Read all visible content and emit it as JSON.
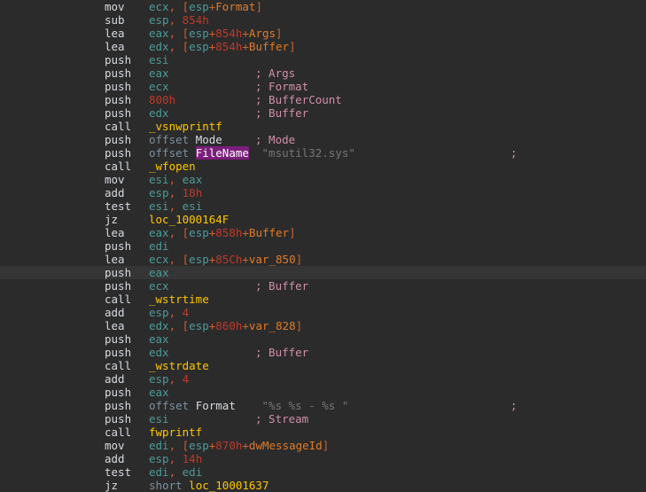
{
  "view": {
    "name": "disassembly-listing",
    "background": "#2b2b2b",
    "current_line_background": "#353535",
    "highlight_background": "#7b1e7b",
    "colors": {
      "mnemonic": "#d6dae0",
      "register": "#4e9a9a",
      "punctuation": "#c9622e",
      "number": "#c0392b",
      "variable": "#e07b28",
      "function": "#ffc600",
      "location": "#ffc600",
      "keyword": "#7d8fa0",
      "comment": "#d08faa",
      "string_comment": "#767676"
    }
  },
  "lines": [
    {
      "mnemonic": "mov",
      "operands": "ecx, [esp+Format]",
      "comment": "",
      "current": false
    },
    {
      "mnemonic": "sub",
      "operands": "esp, 854h",
      "comment": "",
      "current": false
    },
    {
      "mnemonic": "lea",
      "operands": "eax, [esp+854h+Args]",
      "comment": "",
      "current": false
    },
    {
      "mnemonic": "lea",
      "operands": "edx, [esp+854h+Buffer]",
      "comment": "",
      "current": false
    },
    {
      "mnemonic": "push",
      "operands": "esi",
      "comment": "",
      "current": false
    },
    {
      "mnemonic": "push",
      "operands": "eax",
      "comment": "; Args",
      "current": false
    },
    {
      "mnemonic": "push",
      "operands": "ecx",
      "comment": "; Format",
      "current": false
    },
    {
      "mnemonic": "push",
      "operands": "800h",
      "comment": "; BufferCount",
      "current": false
    },
    {
      "mnemonic": "push",
      "operands": "edx",
      "comment": "; Buffer",
      "current": false
    },
    {
      "mnemonic": "call",
      "operands": "_vsnwprintf",
      "comment": "",
      "current": false
    },
    {
      "mnemonic": "push",
      "operands": "offset Mode",
      "comment": "; Mode",
      "current": false
    },
    {
      "mnemonic": "push",
      "operands": "offset FileName",
      "comment": "; \"msutil32.sys\"",
      "current": false
    },
    {
      "mnemonic": "call",
      "operands": "_wfopen",
      "comment": "",
      "current": false
    },
    {
      "mnemonic": "mov",
      "operands": "esi, eax",
      "comment": "",
      "current": false
    },
    {
      "mnemonic": "add",
      "operands": "esp, 18h",
      "comment": "",
      "current": false
    },
    {
      "mnemonic": "test",
      "operands": "esi, esi",
      "comment": "",
      "current": false
    },
    {
      "mnemonic": "jz",
      "operands": "loc_1000164F",
      "comment": "",
      "current": false
    },
    {
      "mnemonic": "lea",
      "operands": "eax, [esp+858h+Buffer]",
      "comment": "",
      "current": false
    },
    {
      "mnemonic": "push",
      "operands": "edi",
      "comment": "",
      "current": false
    },
    {
      "mnemonic": "lea",
      "operands": "ecx, [esp+85Ch+var_850]",
      "comment": "",
      "current": false
    },
    {
      "mnemonic": "push",
      "operands": "eax",
      "comment": "",
      "current": true
    },
    {
      "mnemonic": "push",
      "operands": "ecx",
      "comment": "; Buffer",
      "current": false
    },
    {
      "mnemonic": "call",
      "operands": "_wstrtime",
      "comment": "",
      "current": false
    },
    {
      "mnemonic": "add",
      "operands": "esp, 4",
      "comment": "",
      "current": false
    },
    {
      "mnemonic": "lea",
      "operands": "edx, [esp+860h+var_828]",
      "comment": "",
      "current": false
    },
    {
      "mnemonic": "push",
      "operands": "eax",
      "comment": "",
      "current": false
    },
    {
      "mnemonic": "push",
      "operands": "edx",
      "comment": "; Buffer",
      "current": false
    },
    {
      "mnemonic": "call",
      "operands": "_wstrdate",
      "comment": "",
      "current": false
    },
    {
      "mnemonic": "add",
      "operands": "esp, 4",
      "comment": "",
      "current": false
    },
    {
      "mnemonic": "push",
      "operands": "eax",
      "comment": "",
      "current": false
    },
    {
      "mnemonic": "push",
      "operands": "offset Format",
      "comment": "; \"%s %s - %s \"",
      "current": false
    },
    {
      "mnemonic": "push",
      "operands": "esi",
      "comment": "; Stream",
      "current": false
    },
    {
      "mnemonic": "call",
      "operands": "fwprintf",
      "comment": "",
      "current": false
    },
    {
      "mnemonic": "mov",
      "operands": "edi, [esp+870h+dwMessageId]",
      "comment": "",
      "current": false
    },
    {
      "mnemonic": "add",
      "operands": "esp, 14h",
      "comment": "",
      "current": false
    },
    {
      "mnemonic": "test",
      "operands": "edi, edi",
      "comment": "",
      "current": false
    },
    {
      "mnemonic": "jz",
      "operands": "short loc_10001637",
      "comment": "",
      "current": false
    }
  ]
}
